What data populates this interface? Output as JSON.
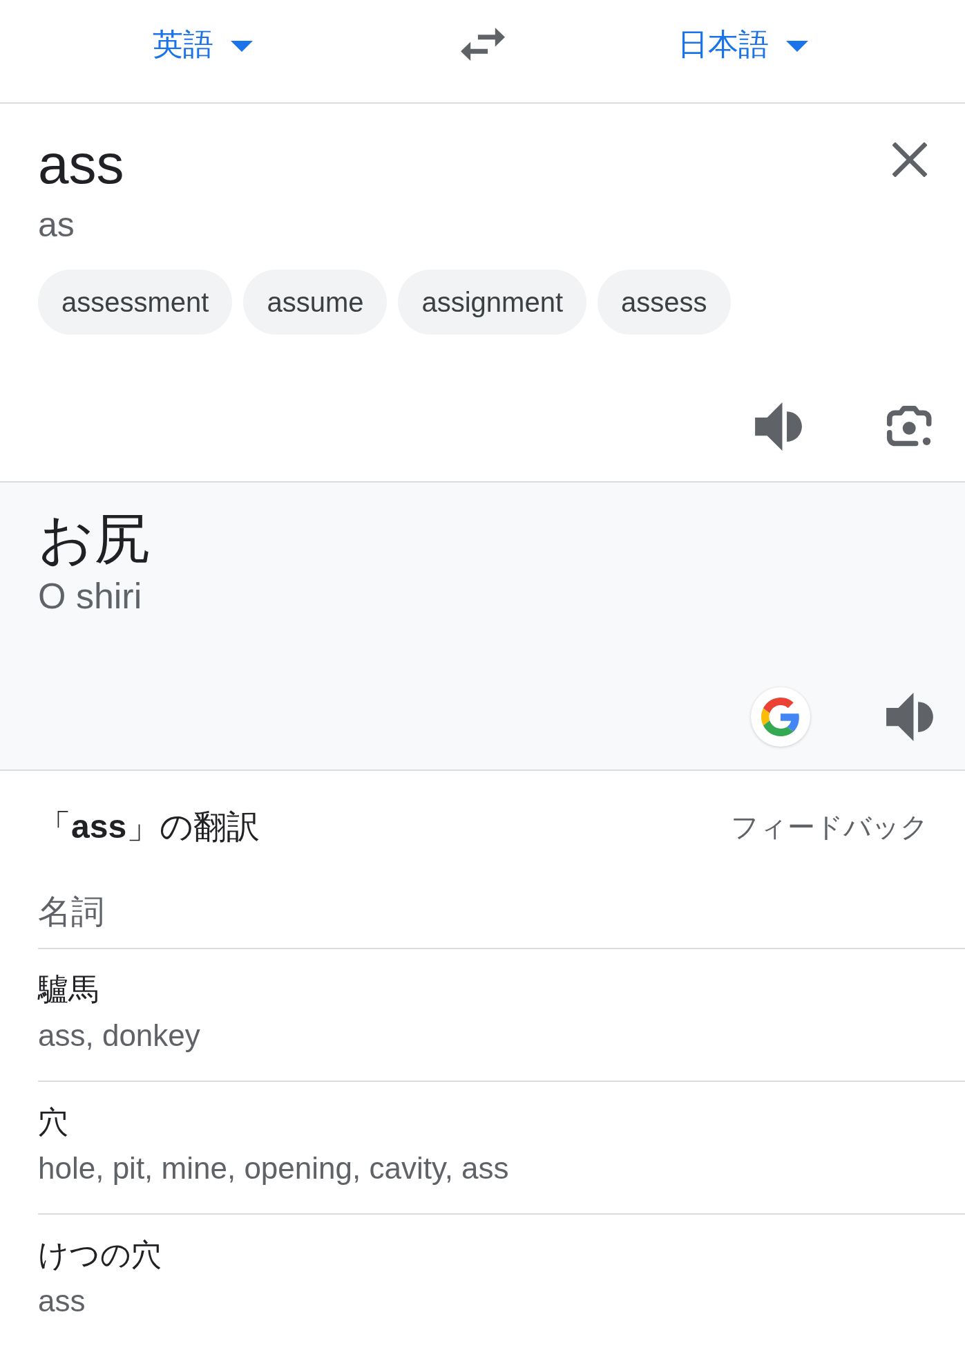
{
  "language_bar": {
    "source_language": {
      "label": "英語"
    },
    "target_language": {
      "label": "日本語"
    }
  },
  "input": {
    "text": "ass",
    "transliteration": "as",
    "suggestions": [
      "assessment",
      "assume",
      "assignment",
      "assess"
    ]
  },
  "translation": {
    "text": "お尻",
    "transliteration": "O shiri"
  },
  "dictionary": {
    "title": "「**ass**」の翻訳",
    "feedback": "フィードバック",
    "sections": [
      {
        "part_of_speech": "名詞",
        "entries": [
          {
            "term": "驢馬",
            "meanings": "ass, donkey"
          },
          {
            "term": "穴",
            "meanings": "hole, pit, mine, opening, cavity, ass"
          },
          {
            "term": "けつの穴",
            "meanings": "ass"
          }
        ]
      }
    ]
  }
}
